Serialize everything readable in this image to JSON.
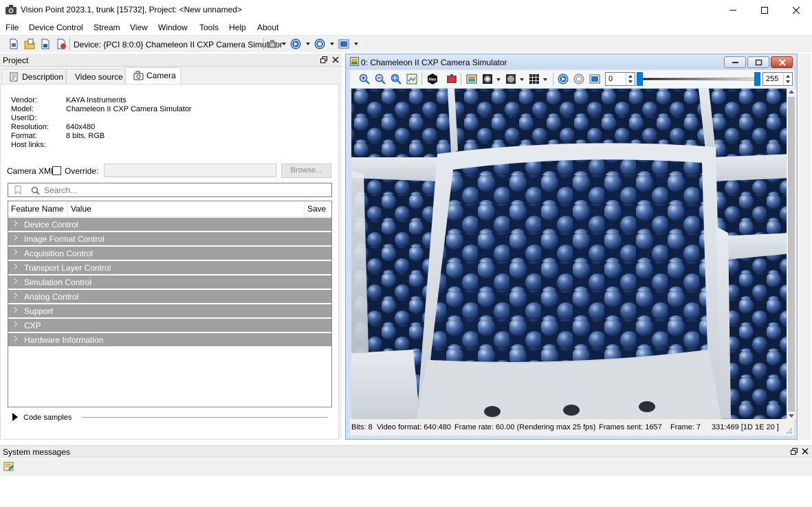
{
  "window": {
    "title": "Vision Point 2023.1, trunk [15732], Project: <New unnamed>",
    "icon": "camera-app-icon"
  },
  "menu": [
    "File",
    "Device Control",
    "Stream",
    "View",
    "Window",
    "Tools",
    "Help",
    "About"
  ],
  "toolbar": {
    "device_label": "Device: {PCI 8:0:0} Chameleon II CXP Camera Simulator",
    "icons": [
      "new-project-icon",
      "open-project-icon",
      "save-project-icon",
      "close-project-icon",
      "camera-select-icon",
      "play-icon",
      "stop-icon",
      "grab-icon"
    ]
  },
  "project_panel": {
    "title": "Project",
    "tabs": [
      "Description",
      "Video source",
      "Camera"
    ],
    "active_tab": "Camera",
    "info": {
      "vendor_label": "Vendor:",
      "vendor": "KAYA Instruments",
      "model_label": "Model:",
      "model": "Chameleon II CXP Camera Simulator",
      "userid_label": "UserID:",
      "userid": "",
      "resolution_label": "Resolution:",
      "resolution": "640x480",
      "format_label": "Format:",
      "format": "8 bits, RGB",
      "hostlinks_label": "Host links:",
      "hostlinks": ""
    },
    "camera_xml_label": "Camera XML",
    "override_label": "Override:",
    "override_checked": false,
    "browse_label": "Browse...",
    "search_placeholder": "Search...",
    "table": {
      "col_feature": "Feature Name",
      "col_value": "Value",
      "col_save": "Save",
      "groups": [
        "Device Control",
        "Image Format Control",
        "Acquisition Control",
        "Transport Layer Control",
        "Simulation Control",
        "Analog Control",
        "Support",
        "CXP",
        "Hardware Information"
      ]
    },
    "code_samples_label": "Code samples"
  },
  "image_window": {
    "title": "0: Chameleon II CXP Camera Simulator",
    "min_value": "0",
    "max_value": "255",
    "min_level": 0.0,
    "max_level": 1.0,
    "status": {
      "bits": "Bits: 8",
      "video_format": "Video format: 640:480",
      "frame_rate": "Frame rate: 60.00 (Rendering max 25 fps)",
      "frames_sent": "Frames sent: 1657",
      "frame": "Frame: 7",
      "pixel": "331:469 [1D 1E 20 ]"
    },
    "image": "blueberries-in-paper-baskets"
  },
  "system_messages": {
    "title": "System messages"
  },
  "colors": {
    "feature_row_bg": "#a0a0a0",
    "toolbar_bg": "#f0f0f0",
    "caption_bg": "#c6d9f0",
    "close_btn": "#c8462a",
    "slider_accent": "#0078d7"
  }
}
